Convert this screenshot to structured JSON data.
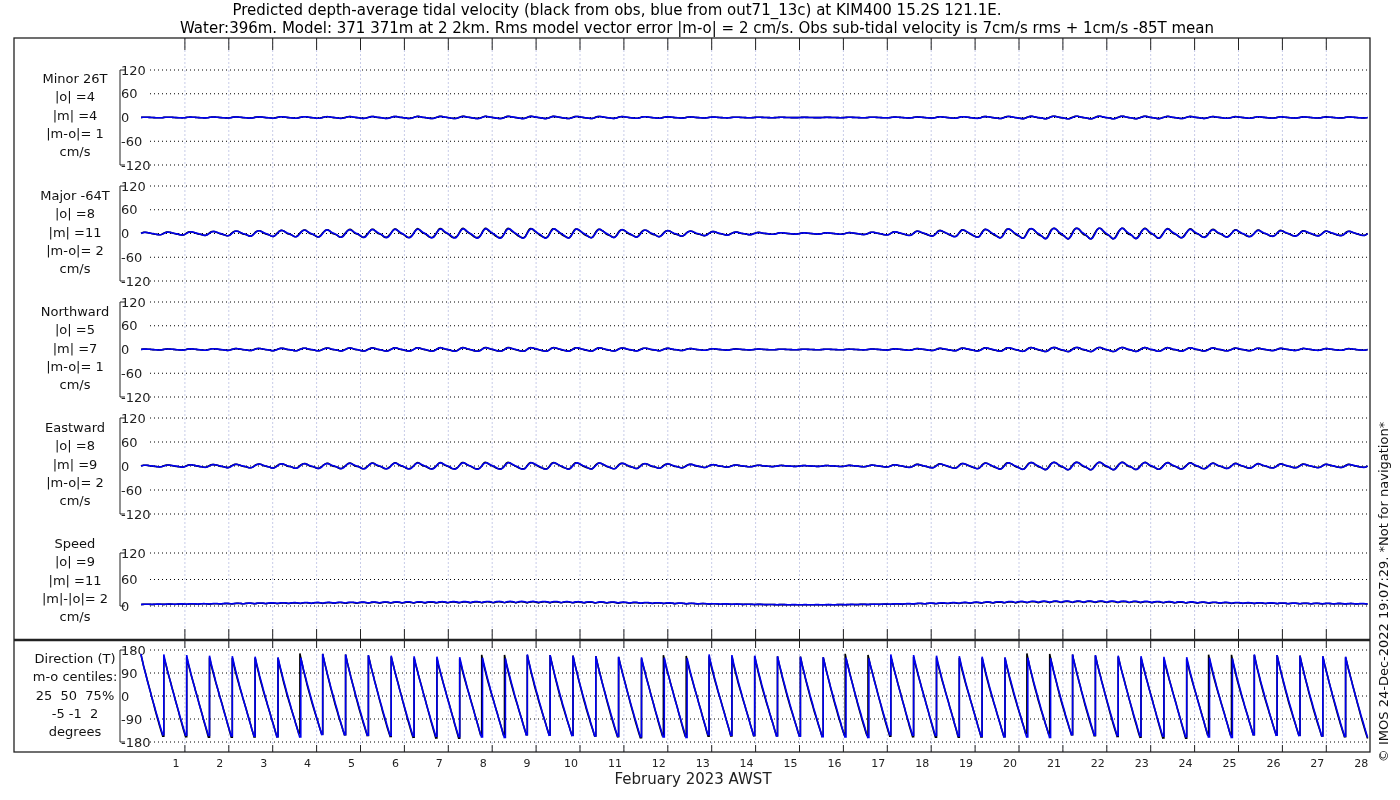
{
  "title_lines": [
    "Predicted depth-average tidal velocity (black from obs, blue from out71_13c) at KIM400 15.2S 121.1E.",
    "Water:396m. Model: 371 371m at 2 2km. Rms model vector error |m-o| = 2 cm/s. Obs sub-tidal velocity is 7cm/s rms + 1cm/s -85T mean"
  ],
  "panels": [
    {
      "kind": "minor",
      "label_lines": [
        "Minor 26T",
        "|o| =4",
        "|m| =4",
        "|m-o|= 1",
        "cm/s"
      ],
      "yticks": [
        "120",
        "60",
        "0",
        "-60",
        "-120"
      ]
    },
    {
      "kind": "major",
      "label_lines": [
        "Major -64T",
        "|o| =8",
        "|m| =11",
        "|m-o|= 2",
        "cm/s"
      ],
      "yticks": [
        "120",
        "60",
        "0",
        "-60",
        "-120"
      ]
    },
    {
      "kind": "northward",
      "label_lines": [
        "Northward",
        "|o| =5",
        "|m| =7",
        "|m-o|= 1",
        "cm/s"
      ],
      "yticks": [
        "120",
        "60",
        "0",
        "-60",
        "-120"
      ]
    },
    {
      "kind": "eastward",
      "label_lines": [
        "Eastward",
        "|o| =8",
        "|m| =9",
        "|m-o|= 2",
        "cm/s"
      ],
      "yticks": [
        "120",
        "60",
        "0",
        "-60",
        "-120"
      ]
    },
    {
      "kind": "speed",
      "label_lines": [
        "Speed",
        "|o| =9",
        "|m| =11",
        "|m|-|o|= 2",
        "cm/s"
      ],
      "yticks": [
        "120",
        "60",
        "0"
      ]
    },
    {
      "kind": "direction",
      "label_lines": [
        "Direction (T)",
        "m-o centiles:",
        "25  50  75%",
        "-5 -1  2",
        "degrees"
      ],
      "yticks": [
        "180",
        "90",
        "0",
        "-90",
        "-180"
      ]
    }
  ],
  "xaxis": {
    "ticks": [
      "1",
      "2",
      "3",
      "4",
      "5",
      "6",
      "7",
      "8",
      "9",
      "10",
      "11",
      "12",
      "13",
      "14",
      "15",
      "16",
      "17",
      "18",
      "19",
      "20",
      "21",
      "22",
      "23",
      "24",
      "25",
      "26",
      "27",
      "28"
    ],
    "label": "February 2023 AWST"
  },
  "footer_note": "© IMOS 24-Dec-2022 19:07:29.  *Not for navigation*"
}
